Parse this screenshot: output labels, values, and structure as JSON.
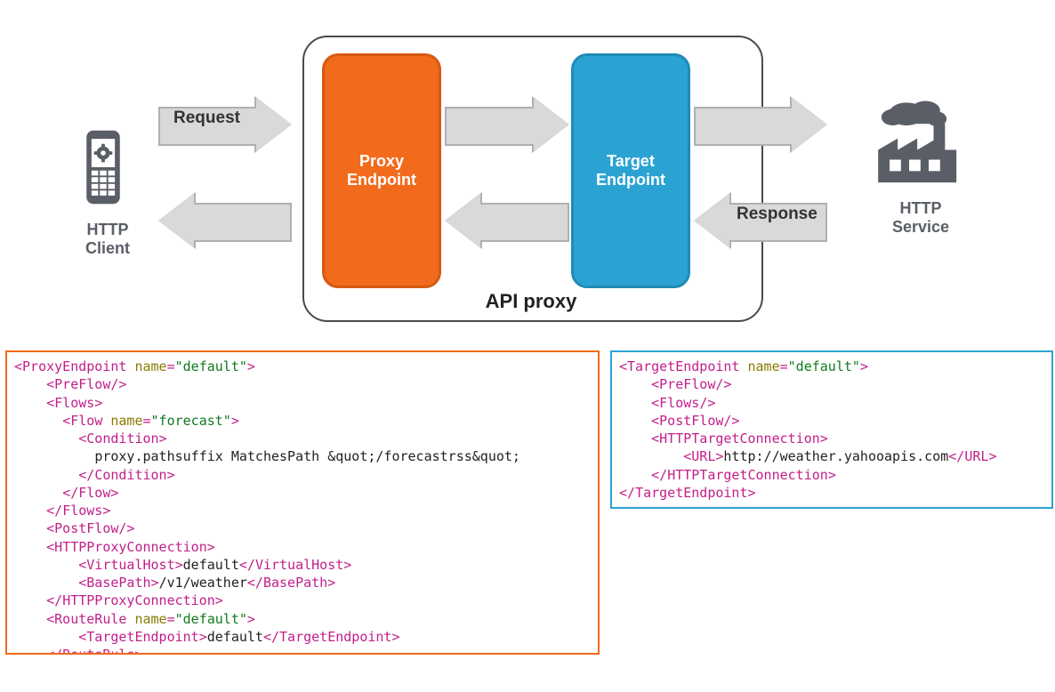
{
  "diagram": {
    "client_label": "HTTP\nClient",
    "service_label": "HTTP\nService",
    "request_label": "Request",
    "response_label": "Response",
    "proxy_container_label": "API proxy",
    "proxy_endpoint_label": "Proxy\nEndpoint",
    "target_endpoint_label": "Target\nEndpoint"
  },
  "colors": {
    "orange": "#f26a1b",
    "blue": "#2aa3d3",
    "icon_gray": "#5a5e66",
    "arrow_fill": "#d9d9d9",
    "arrow_stroke": "#b0b0b0"
  },
  "proxy_xml": {
    "root_tag": "ProxyEndpoint",
    "root_attr_name": "name",
    "root_attr_val": "\"default\"",
    "preflow": "PreFlow",
    "flows": "Flows",
    "flow": "Flow",
    "flow_attr_name": "name",
    "flow_attr_val": "\"forecast\"",
    "condition": "Condition",
    "condition_text": "proxy.pathsuffix MatchesPath &quot;/forecastrss&quot;",
    "postflow": "PostFlow",
    "httpproxy": "HTTPProxyConnection",
    "vhost": "VirtualHost",
    "vhost_text": "default",
    "basepath": "BasePath",
    "basepath_text": "/v1/weather",
    "routerule": "RouteRule",
    "routerule_attr_name": "name",
    "routerule_attr_val": "\"default\"",
    "targetendpoint": "TargetEndpoint",
    "targetendpoint_text": "default"
  },
  "target_xml": {
    "root_tag": "TargetEndpoint",
    "root_attr_name": "name",
    "root_attr_val": "\"default\"",
    "preflow": "PreFlow",
    "flows": "Flows",
    "postflow": "PostFlow",
    "httptarget": "HTTPTargetConnection",
    "url": "URL",
    "url_text": "http://weather.yahooapis.com"
  }
}
